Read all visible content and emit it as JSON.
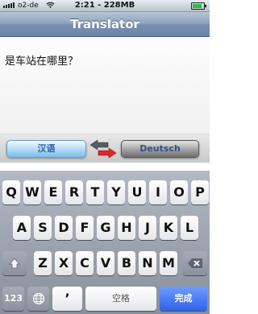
{
  "status_bar": {
    "carrier": "o2-de",
    "time": "2:21 - 228MB",
    "battery_level": 0.9
  },
  "nav": {
    "title": "Translator"
  },
  "input": {
    "text": "是车站在哪里？"
  },
  "languages": {
    "source": "汉语",
    "target": "Deutsch"
  },
  "keyboard": {
    "row1": [
      "Q",
      "W",
      "E",
      "R",
      "T",
      "Y",
      "U",
      "I",
      "O",
      "P"
    ],
    "row2": [
      "A",
      "S",
      "D",
      "F",
      "G",
      "H",
      "J",
      "K",
      "L"
    ],
    "row3": [
      "Z",
      "X",
      "C",
      "V",
      "B",
      "N",
      "M"
    ],
    "numbers_key": "123",
    "apostrophe_key": "’",
    "space_key": "空格",
    "done_key": "完成"
  },
  "icons": {
    "wifi": "wifi-icon",
    "shift": "shift-icon",
    "backspace": "backspace-icon",
    "globe": "globe-icon",
    "swap": "swap-arrows-icon"
  }
}
